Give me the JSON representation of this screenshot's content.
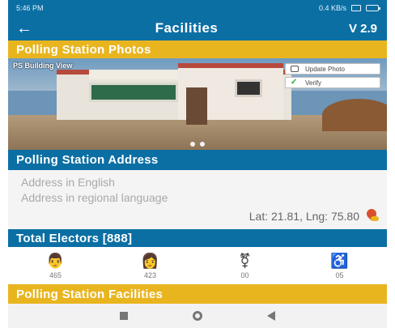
{
  "status_bar": {
    "time": "5:46 PM",
    "network_speed": "0.4 KB/s"
  },
  "app_bar": {
    "back_icon": "arrow-left-icon",
    "title": "Facilities",
    "version": "V 2.9"
  },
  "photos_section": {
    "header": "Polling Station Photos",
    "photo_label": "PS Building View",
    "update_photo_label": "Update Photo",
    "verify_label": "Verify",
    "carousel_pages": 2,
    "current_page": 1
  },
  "address_section": {
    "header": "Polling Station Address",
    "address_english_placeholder": "Address in English",
    "address_regional_placeholder": "Address in regional language",
    "latlng": "Lat: 21.81, Lng: 75.80"
  },
  "electors_section": {
    "header": "Total Electors [888]",
    "groups": [
      {
        "icon": "male-icon",
        "count": "465"
      },
      {
        "icon": "female-icon",
        "count": "423"
      },
      {
        "icon": "third-gender-icon",
        "count": "00"
      },
      {
        "icon": "wheelchair-icon",
        "count": "05"
      }
    ]
  },
  "facilities_section": {
    "header": "Polling Station Facilities"
  },
  "colors": {
    "primary": "#0b6fa4",
    "accent": "#e9b51f"
  }
}
